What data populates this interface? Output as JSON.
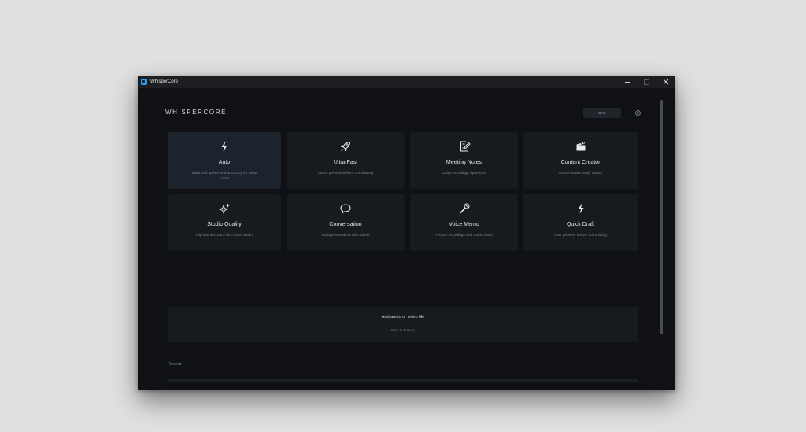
{
  "window": {
    "title": "WhisperCore",
    "controls": {
      "minimize_icon": "minimize-icon",
      "maximize_icon": "maximize-icon",
      "close_icon": "close-icon"
    }
  },
  "header": {
    "brand": "WHISPERCORE",
    "beta_label": "Beta",
    "settings_icon": "gear-icon"
  },
  "modes": [
    {
      "name": "Auto",
      "description": "Balanced speed and accuracy for most cases",
      "icon": "lightning-icon",
      "selected": true
    },
    {
      "name": "Ultra Fast",
      "description": "Quick preview before committing",
      "icon": "rocket-icon",
      "selected": false
    },
    {
      "name": "Meeting Notes",
      "description": "Long recordings optimized",
      "icon": "notes-icon",
      "selected": false
    },
    {
      "name": "Content Creator",
      "description": "Social media ready output",
      "icon": "clapperboard-icon",
      "selected": false
    },
    {
      "name": "Studio Quality",
      "description": "Highest accuracy for critical audio",
      "icon": "sparkles-icon",
      "selected": false
    },
    {
      "name": "Conversation",
      "description": "Multiple speakers with labels",
      "icon": "speech-bubble-icon",
      "selected": false
    },
    {
      "name": "Voice Memo",
      "description": "Phone recordings and quick notes",
      "icon": "microphone-icon",
      "selected": false
    },
    {
      "name": "Quick Draft",
      "description": "Fast preview before committing",
      "icon": "lightning-icon",
      "selected": false
    }
  ],
  "dropzone": {
    "title": "Add audio or video file",
    "subtitle": "Click to browse"
  },
  "recent": {
    "label": "Recent"
  },
  "colors": {
    "window_bg": "#0f1115",
    "card_bg": "#171a1f",
    "card_active_bg": "#1d232c",
    "accent": "#2a9df4"
  }
}
